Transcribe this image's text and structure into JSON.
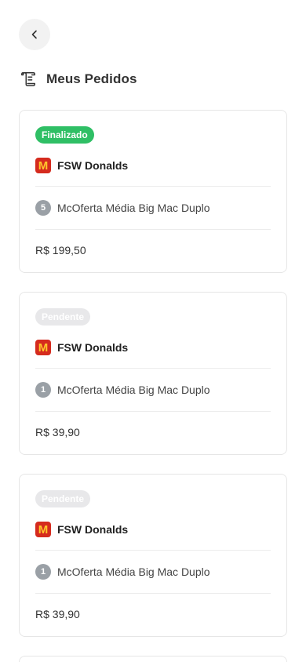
{
  "header": {
    "back_icon": "chevron-left-icon",
    "orders_icon": "scroll-icon",
    "title": "Meus Pedidos"
  },
  "colors": {
    "finished": "#2fbf65",
    "pending": "#e8e8ea",
    "brand": "#d52b1e"
  },
  "orders": [
    {
      "status": "Finalizado",
      "restaurant": "FSW Donalds",
      "restaurant_logo": "M",
      "quantity": "5",
      "item": "McOferta Média Big Mac Duplo",
      "total": "R$ 199,50"
    },
    {
      "status": "Pendente",
      "restaurant": "FSW Donalds",
      "restaurant_logo": "M",
      "quantity": "1",
      "item": "McOferta Média Big Mac Duplo",
      "total": "R$ 39,90"
    },
    {
      "status": "Pendente",
      "restaurant": "FSW Donalds",
      "restaurant_logo": "M",
      "quantity": "1",
      "item": "McOferta Média Big Mac Duplo",
      "total": "R$ 39,90"
    }
  ]
}
